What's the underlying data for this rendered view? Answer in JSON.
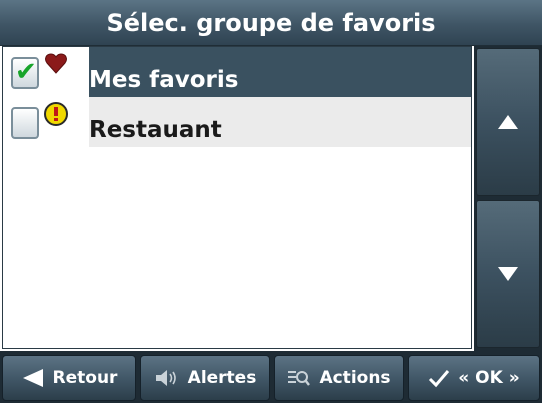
{
  "title": "Sélec. groupe de favoris",
  "list": {
    "items": [
      {
        "label": "Mes favoris",
        "checked": true,
        "badge_icon": "heart-icon",
        "selected": true
      },
      {
        "label": "Restauant",
        "checked": false,
        "badge_icon": "exclamation-icon",
        "selected": false
      }
    ]
  },
  "scroll": {
    "up_icon": "arrow-up-icon",
    "down_icon": "arrow-down-icon"
  },
  "toolbar": {
    "retour_label": "Retour",
    "alertes_label": "Alertes",
    "actions_label": "Actions",
    "ok_label": "« OK »"
  },
  "colors": {
    "title_bar": "#3f5565",
    "selected_row": "#3a5160",
    "unselected_row": "#ebebeb",
    "check_green": "#18a42a",
    "heart_red": "#8b1a1a",
    "alert_yellow": "#f0d800"
  }
}
